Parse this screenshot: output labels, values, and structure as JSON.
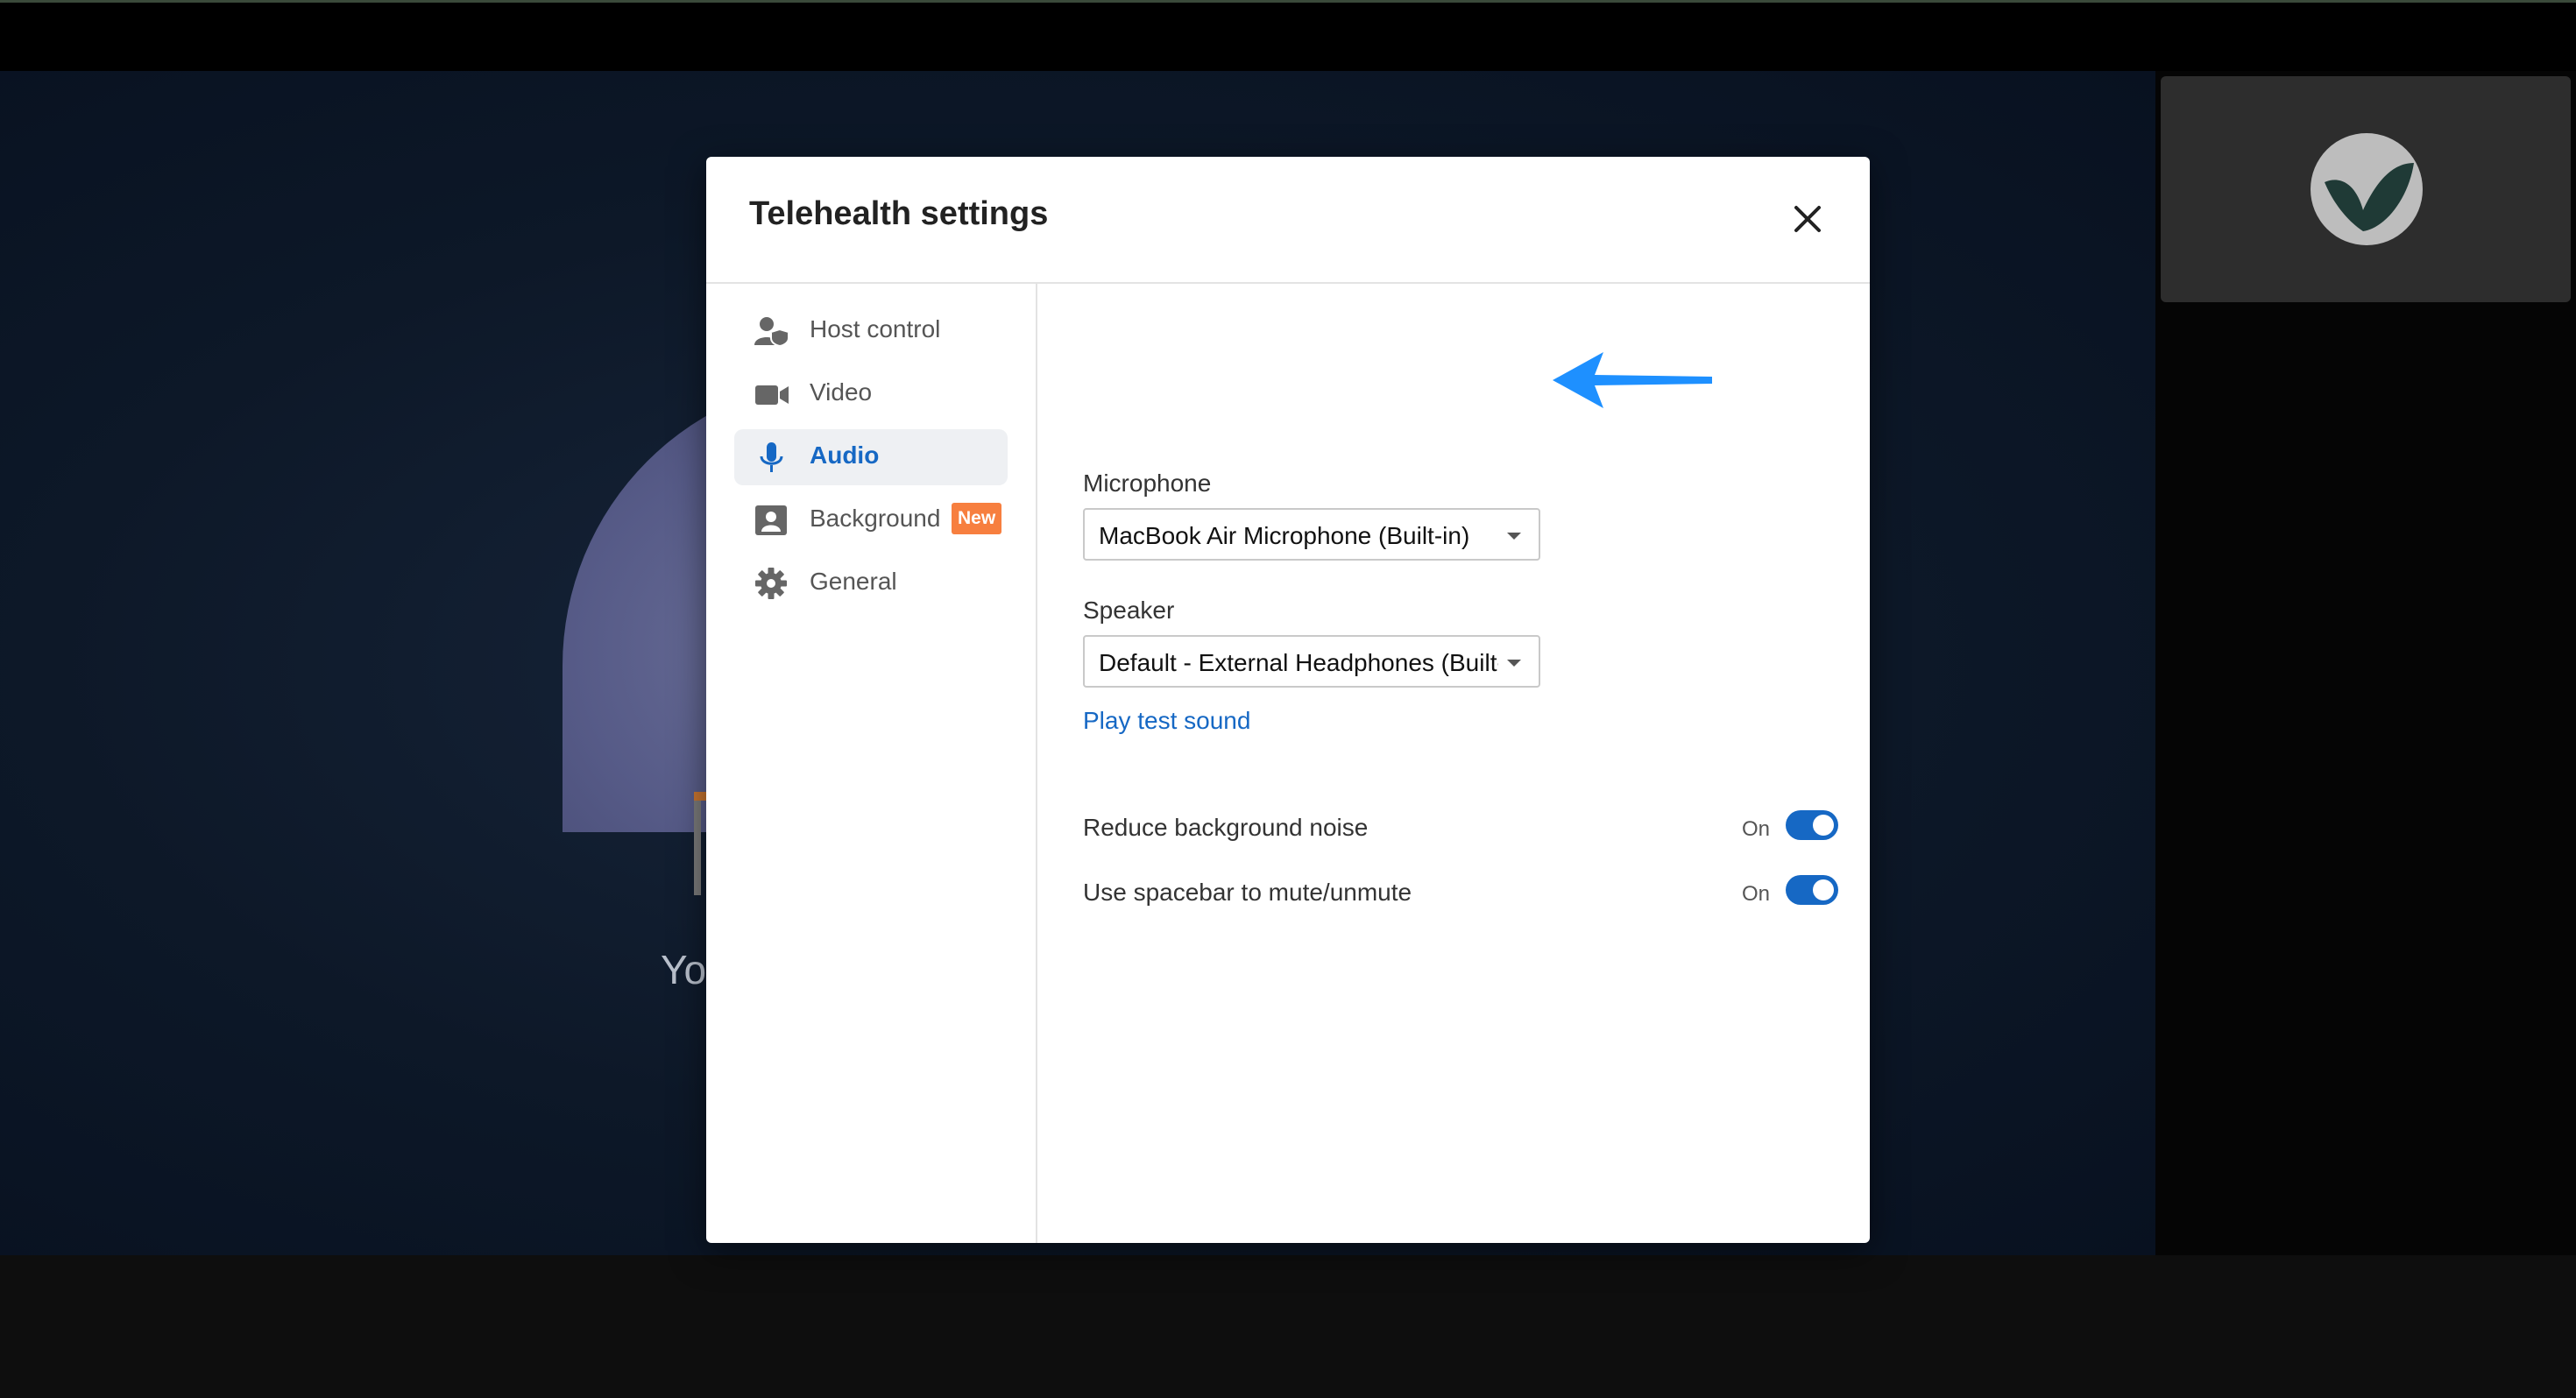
{
  "background": {
    "partial_label": "Yo"
  },
  "modal": {
    "title": "Telehealth settings"
  },
  "sidebar": {
    "items": [
      {
        "label": "Host control",
        "icon": "host-control-icon"
      },
      {
        "label": "Video",
        "icon": "video-camera-icon"
      },
      {
        "label": "Audio",
        "icon": "microphone-icon",
        "active": true
      },
      {
        "label": "Background",
        "icon": "background-portrait-icon",
        "badge": "New"
      },
      {
        "label": "General",
        "icon": "gear-icon"
      }
    ]
  },
  "audio": {
    "microphone_label": "Microphone",
    "microphone_value": "MacBook Air Microphone (Built-in)",
    "speaker_label": "Speaker",
    "speaker_value": "Default - External Headphones (Built-in)",
    "play_test_sound": "Play test sound",
    "toggles": [
      {
        "label": "Reduce background noise",
        "state": "On"
      },
      {
        "label": "Use spacebar to mute/unmute",
        "state": "On"
      }
    ]
  },
  "colors": {
    "accent": "#1668c4",
    "badge": "#f77f3f",
    "annotation_arrow": "#1e90ff"
  }
}
